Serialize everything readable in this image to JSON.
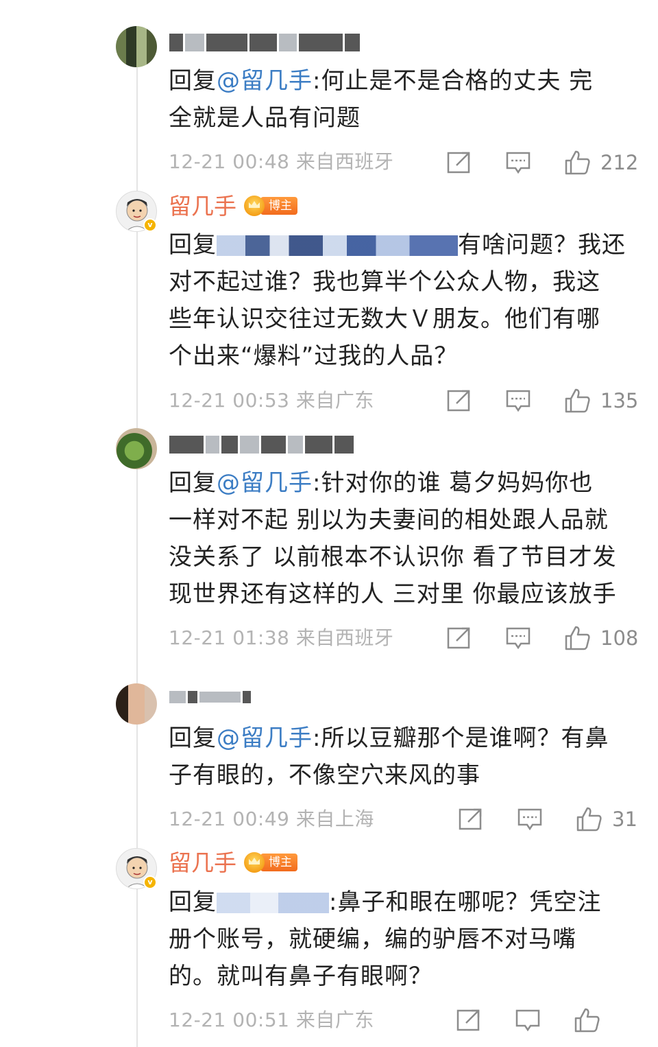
{
  "comments": [
    {
      "reply_prefix": "回复",
      "mention": "@留几手",
      "body_lines": [
        ":何止是不是合格的丈夫 完",
        "全就是人品有问题"
      ],
      "meta": "12-21 00:48 来自西班牙",
      "likes": "212"
    },
    {
      "author": "留几手",
      "badge": "博主",
      "reply_prefix": "回复",
      "body_first_tail": "有啥问题？我还",
      "body_lines": [
        "对不起过谁？我也算半个公众人物，我这",
        "些年认识交往过无数大Ｖ朋友。他们有哪",
        "个出来“爆料”过我的人品？"
      ],
      "meta": "12-21 00:53 来自广东",
      "likes": "135"
    },
    {
      "reply_prefix": "回复",
      "mention": "@留几手",
      "body_lines": [
        ":针对你的谁 葛夕妈妈你也",
        "一样对不起 别以为夫妻间的相处跟人品就",
        "没关系了 以前根本不认识你 看了节目才发",
        "现世界还有这样的人 三对里 你最应该放手"
      ],
      "meta": "12-21 01:38 来自西班牙",
      "likes": "108"
    },
    {
      "reply_prefix": "回复",
      "mention": "@留几手",
      "body_lines": [
        ":所以豆瓣那个是谁啊？有鼻",
        "子有眼的，不像空穴来风的事"
      ],
      "meta": "12-21 00:49 来自上海",
      "likes": "31"
    },
    {
      "author": "留几手",
      "badge": "博主",
      "reply_prefix": "回复",
      "body_first_tail": ":鼻子和眼在哪呢？凭空注",
      "body_lines": [
        "册个账号，就硬编，编的驴唇不对马嘴",
        "的。就叫有鼻子有眼啊？"
      ],
      "meta": "12-21 00:51 来自广东",
      "likes": ""
    }
  ],
  "colors": {
    "author": "#eb7350",
    "mention": "#3c7dc4",
    "meta": "#b3b3b3",
    "badge": "#f26b1d"
  },
  "icons": [
    "share-icon",
    "comment-icon",
    "like-icon"
  ]
}
